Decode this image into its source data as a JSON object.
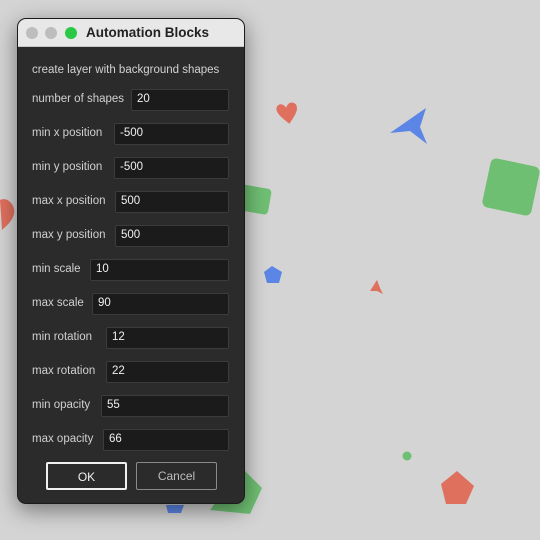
{
  "window": {
    "title": "Automation Blocks"
  },
  "form": {
    "heading": "create layer with background shapes",
    "fields": [
      {
        "label": "number of shapes",
        "value": "20"
      },
      {
        "label": "min x position",
        "value": "-500"
      },
      {
        "label": "min y position",
        "value": "-500"
      },
      {
        "label": "max x position",
        "value": "500"
      },
      {
        "label": "max y position",
        "value": "500"
      },
      {
        "label": "min scale",
        "value": "10"
      },
      {
        "label": "max scale",
        "value": "90"
      },
      {
        "label": "min rotation",
        "value": "12"
      },
      {
        "label": "max rotation",
        "value": "22"
      },
      {
        "label": "min opacity",
        "value": "55"
      },
      {
        "label": "max opacity",
        "value": "66"
      }
    ],
    "ok_label": "OK",
    "cancel_label": "Cancel"
  },
  "colors": {
    "background": "#d4d4d4",
    "dialog": "#2b2b2b",
    "shape_green": "#6fbf73",
    "shape_blue": "#5b86e5",
    "shape_red": "#e0705e",
    "traffic_green": "#2ac845"
  }
}
